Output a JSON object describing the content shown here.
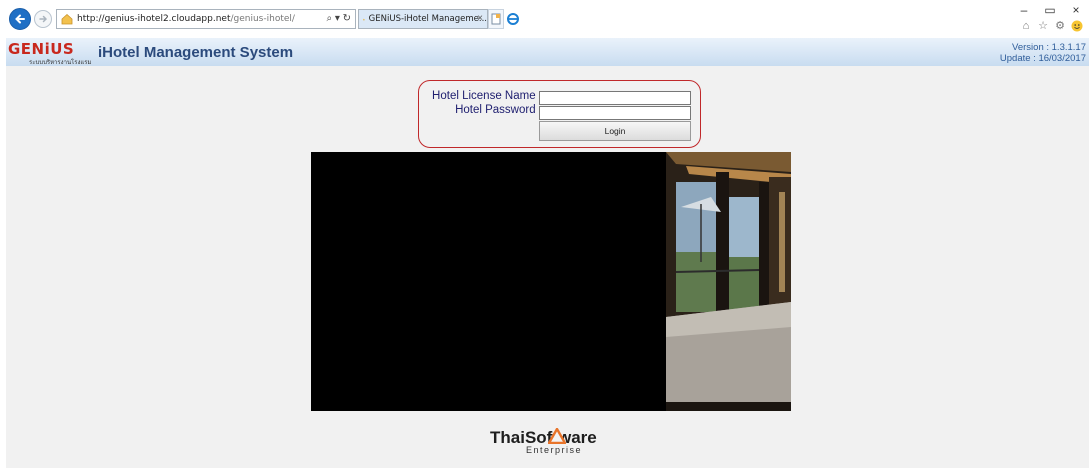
{
  "browser": {
    "url_host": "http://genius-ihotel2.cloudapp.net",
    "url_path": "/genius-ihotel/",
    "search_glyph": "⌕ ▾ ↻",
    "tab_title": "GENiUS-iHotel Manageme...",
    "tab_close": "×",
    "window_controls": {
      "minimize": "–",
      "restore": "▭",
      "close": "×"
    },
    "icons": [
      "back-arrow-icon",
      "forward-arrow-icon",
      "home-icon",
      "star-icon",
      "gear-icon",
      "smiley-icon"
    ],
    "colors": {
      "back_button": "#1f6fc5",
      "tab_bg": "#dbe8f6"
    }
  },
  "header": {
    "logo": "GENiUS",
    "logo_subtitle": "ระบบบริหารงานโรงแรม",
    "title": "iHotel Management System",
    "version": "Version : 1.3.1.17",
    "update": "Update : 16/03/2017"
  },
  "login": {
    "license_label": "Hotel License Name :",
    "password_label": "Hotel Password :",
    "license_value": "",
    "password_value": "",
    "login_button": "Login",
    "frame_color": "#c0282a"
  },
  "footer": {
    "brand": "ThaiSoftware",
    "tagline": "Enterprise"
  },
  "colors": {
    "brand_red": "#c8281e",
    "title_blue": "#2b4a7c",
    "version_blue": "#2f5d9a",
    "label_navy": "#202070",
    "content_bg": "#f1f1f1"
  }
}
